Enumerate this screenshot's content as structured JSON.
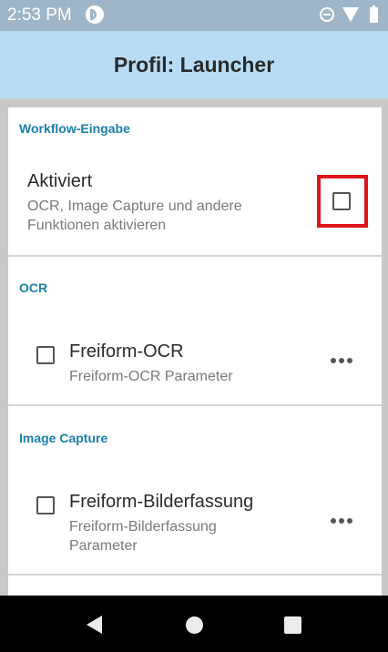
{
  "status_bar": {
    "time": "2:53 PM",
    "app_icon": "app-notification-icon",
    "wifi_badge": "5"
  },
  "header": {
    "title": "Profil: Launcher"
  },
  "sections": [
    {
      "header": "Workflow-Eingabe",
      "item": {
        "title": "Aktiviert",
        "summary": "OCR, Image Capture und andere Funktionen aktivieren",
        "checked": false
      }
    },
    {
      "header": "OCR",
      "item": {
        "title": "Freiform-OCR",
        "summary": "Freiform-OCR Parameter",
        "checked": false
      }
    },
    {
      "header": "Image Capture",
      "item": {
        "title": "Freiform-Bilderfassung",
        "summary": "Freiform-Bilderfassung Parameter",
        "checked": false
      }
    }
  ],
  "colors": {
    "section_header": "#1a80a8",
    "app_bar": "#b8dcf5",
    "highlight": "#e0141c"
  },
  "nav": {
    "back": "back-icon",
    "home": "home-icon",
    "recents": "recents-icon"
  }
}
